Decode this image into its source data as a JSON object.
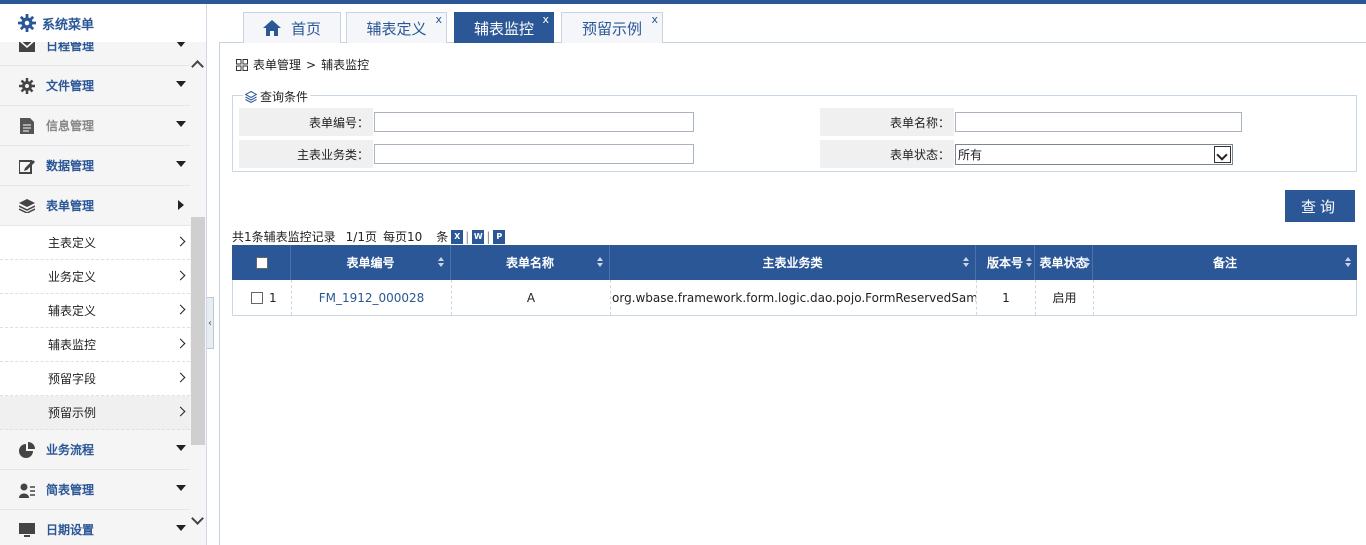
{
  "sidebar": {
    "title": "系统菜单",
    "items": [
      {
        "label": "日程管理",
        "icon": "envelope-icon"
      },
      {
        "label": "文件管理",
        "icon": "gear-icon"
      },
      {
        "label": "信息管理",
        "icon": "document-icon"
      },
      {
        "label": "数据管理",
        "icon": "edit-icon"
      },
      {
        "label": "表单管理",
        "icon": "layers-icon"
      }
    ],
    "subitems": [
      "主表定义",
      "业务定义",
      "辅表定义",
      "辅表监控",
      "预留字段",
      "预留示例"
    ],
    "bottom_items": [
      {
        "label": "业务流程",
        "icon": "pie-chart-icon"
      },
      {
        "label": "简表管理",
        "icon": "user-card-icon"
      },
      {
        "label": "日期设置",
        "icon": "monitor-icon"
      }
    ]
  },
  "tabs": [
    {
      "label": "首页"
    },
    {
      "label": "辅表定义"
    },
    {
      "label": "辅表监控"
    },
    {
      "label": "预留示例"
    }
  ],
  "tab_close": "x",
  "breadcrumb": {
    "parent": "表单管理",
    "separator": ">",
    "current": "辅表监控"
  },
  "query": {
    "legend": "查询条件",
    "form_code_label": "表单编号：",
    "form_code_value": "",
    "form_name_label": "表单名称：",
    "form_name_value": "",
    "business_label": "主表业务类：",
    "business_value": "",
    "status_label": "表单状态：",
    "status_value": "所有",
    "button": "查询"
  },
  "summary": {
    "records": "共1条辅表监控记录",
    "pages": "1/1页",
    "per_page": "每页10",
    "unit": "条"
  },
  "export_icons": [
    "excel-export-icon",
    "word-export-icon",
    "pdf-export-icon"
  ],
  "table": {
    "headers": [
      "表单编号",
      "表单名称",
      "主表业务类",
      "版本号",
      "表单状态",
      "备注"
    ],
    "rows": [
      {
        "index": "1",
        "code": "FM_1912_000028",
        "name": "A",
        "business": "org.wbase.framework.form.logic.dao.pojo.FormReservedSample",
        "version": "1",
        "status": "启用",
        "remark": ""
      }
    ]
  },
  "colors": {
    "primary": "#2b5797",
    "header_bg": "#2b5797",
    "label_bg": "#f0f0f0"
  }
}
